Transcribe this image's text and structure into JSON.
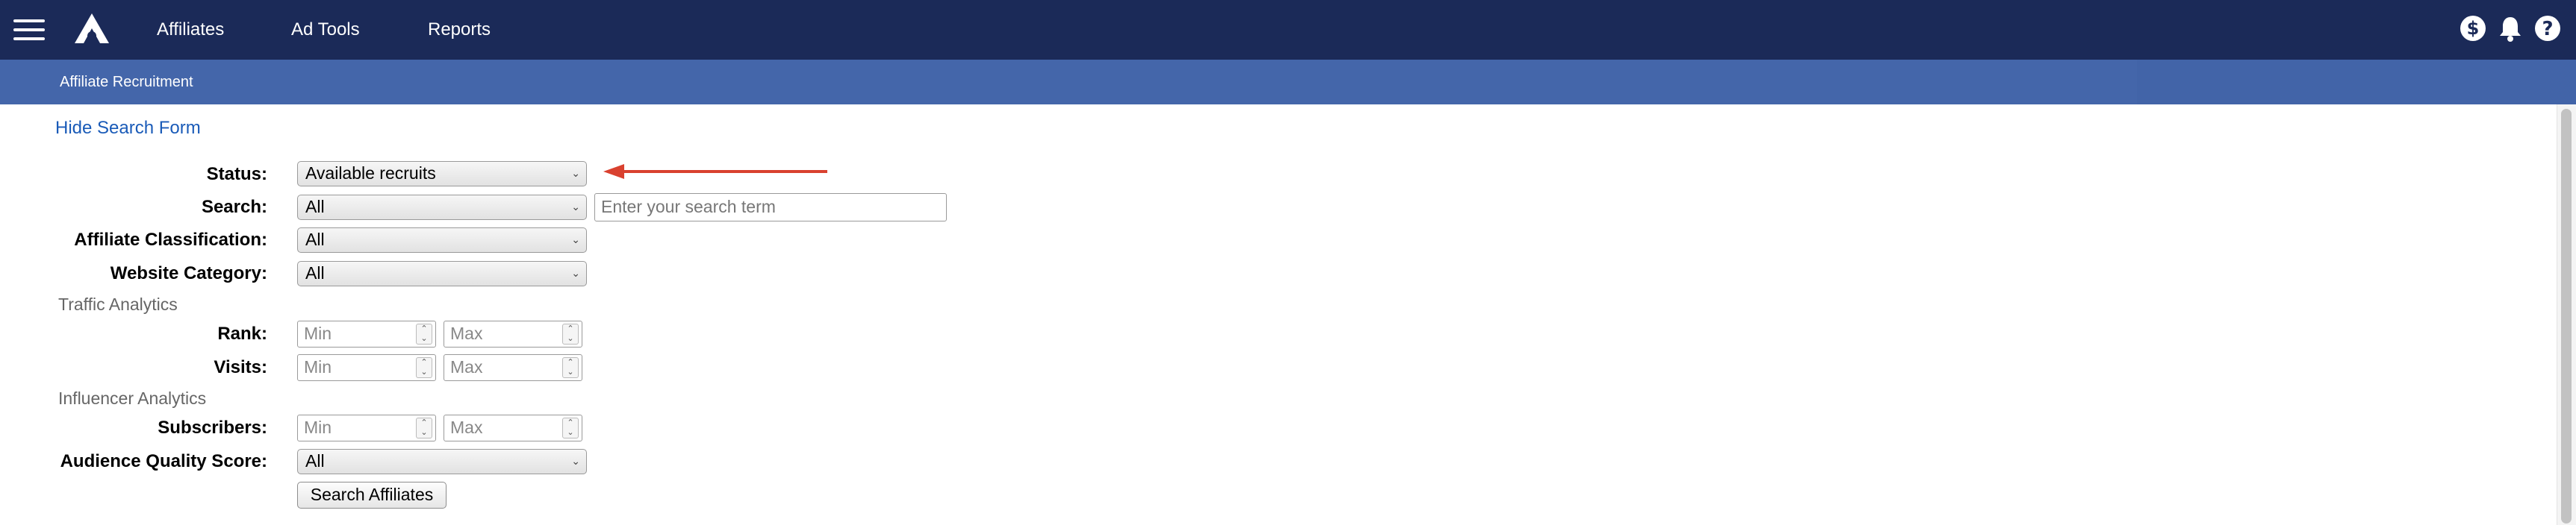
{
  "nav": {
    "items": [
      "Affiliates",
      "Ad Tools",
      "Reports"
    ]
  },
  "subbar": {
    "title": "Affiliate Recruitment"
  },
  "form": {
    "hide_link": "Hide Search Form",
    "status_label": "Status:",
    "status_value": "Available recruits",
    "search_label": "Search:",
    "search_scope_value": "All",
    "search_placeholder": "Enter your search term",
    "classification_label": "Affiliate Classification:",
    "classification_value": "All",
    "category_label": "Website Category:",
    "category_value": "All",
    "traffic_section": "Traffic Analytics",
    "rank_label": "Rank:",
    "visits_label": "Visits:",
    "influencer_section": "Influencer Analytics",
    "subscribers_label": "Subscribers:",
    "audience_label": "Audience Quality Score:",
    "audience_value": "All",
    "min_placeholder": "Min",
    "max_placeholder": "Max",
    "search_button": "Search Affiliates"
  },
  "icons": {
    "menu": "hamburger-menu-icon",
    "logo": "brand-logo-icon",
    "earnings": "dollar-circle-icon",
    "notifications": "bell-icon",
    "help": "help-circle-icon",
    "annotation": "red-arrow-icon"
  },
  "colors": {
    "topbar": "#1b2a58",
    "subbar": "#4466aa",
    "link": "#1a5bb8",
    "arrow": "#d9412f"
  }
}
